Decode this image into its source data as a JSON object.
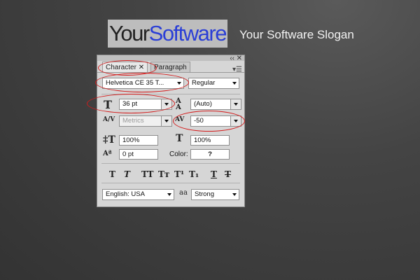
{
  "logo": {
    "part1": "Your",
    "part2": "Software"
  },
  "slogan": "Your Software Slogan",
  "panel": {
    "window_controls": {
      "collapse": "‹‹",
      "close": "✕"
    },
    "tabs": [
      {
        "label": "Character",
        "close": "✕"
      },
      {
        "label": "Paragraph"
      }
    ],
    "font_family": "Helvetica CE 35 T...",
    "font_style": "Regular",
    "font_size": "36 pt",
    "leading": "(Auto)",
    "kerning": "Metrics",
    "tracking": "-50",
    "vertical_scale": "100%",
    "horizontal_scale": "100%",
    "baseline_shift": "0 pt",
    "color_label": "Color:",
    "color_value": "?",
    "language": "English: USA",
    "antialias_icon": "aa",
    "antialias": "Strong",
    "style_buttons": [
      "T",
      "T",
      "TT",
      "Tт",
      "T¹",
      "T₁",
      "T",
      "T"
    ]
  },
  "colors": {
    "annotation": "#d41b1b",
    "logo_blue": "#2b3fd6"
  }
}
